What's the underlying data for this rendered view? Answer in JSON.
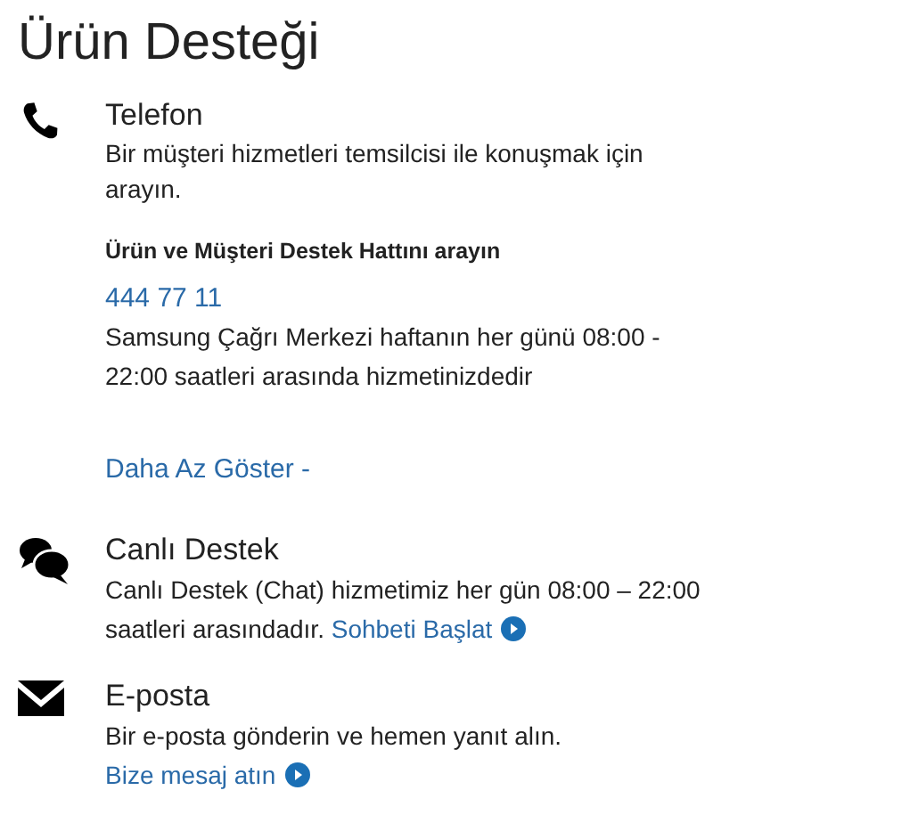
{
  "title": "Ürün Desteği",
  "sections": [
    {
      "kind": "phone",
      "title": "Telefon",
      "description": "Bir müşteri hizmetleri temsilcisi ile konuşmak için arayın.",
      "hotline_heading": "Ürün ve Müşteri Destek Hattını arayın",
      "phone_number": "444 77 11",
      "hours": "Samsung Çağrı Merkezi haftanın her günü 08:00 - 22:00 saatleri arasında hizmetinizdedir",
      "toggle_link": "Daha Az Göster -"
    },
    {
      "kind": "chat",
      "title": "Canlı Destek",
      "description": "Canlı Destek (Chat) hizmetimiz her gün 08:00 – 22:00 saatleri arasındadır.",
      "link": "Sohbeti Başlat"
    },
    {
      "kind": "email",
      "title": "E-posta",
      "description": "Bir e-posta gönderin ve hemen yanıt alın.",
      "link": "Bize mesaj atın"
    }
  ]
}
